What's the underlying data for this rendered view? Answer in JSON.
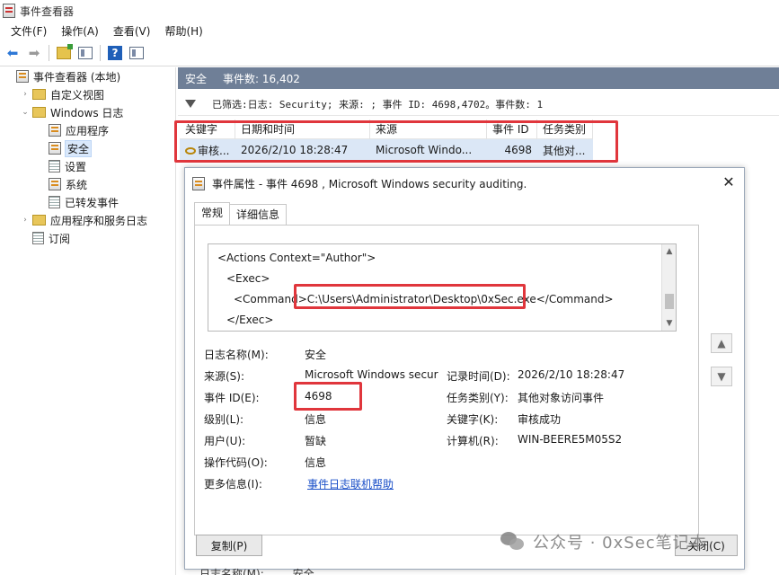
{
  "window": {
    "title": "事件查看器"
  },
  "menu": [
    "文件(F)",
    "操作(A)",
    "查看(V)",
    "帮助(H)"
  ],
  "toolbar": {
    "help_label": "?"
  },
  "tree": [
    {
      "label": "事件查看器 (本地)",
      "indent": 0,
      "caret": "",
      "icon": "node"
    },
    {
      "label": "自定义视图",
      "indent": 1,
      "caret": "›",
      "icon": "folder"
    },
    {
      "label": "Windows 日志",
      "indent": 1,
      "caret": "⌄",
      "icon": "folder"
    },
    {
      "label": "应用程序",
      "indent": 2,
      "caret": "",
      "icon": "node"
    },
    {
      "label": "安全",
      "indent": 2,
      "caret": "",
      "icon": "node",
      "selected": true
    },
    {
      "label": "设置",
      "indent": 2,
      "caret": "",
      "icon": "sub"
    },
    {
      "label": "系统",
      "indent": 2,
      "caret": "",
      "icon": "node"
    },
    {
      "label": "已转发事件",
      "indent": 2,
      "caret": "",
      "icon": "sub"
    },
    {
      "label": "应用程序和服务日志",
      "indent": 1,
      "caret": "›",
      "icon": "folder"
    },
    {
      "label": "订阅",
      "indent": 1,
      "caret": "",
      "icon": "sub"
    }
  ],
  "main": {
    "title": "安全",
    "event_count": "事件数: 16,402",
    "filter_text": "已筛选:日志: Security; 来源: ; 事件 ID: 4698,4702。事件数: 1",
    "columns": [
      "关键字",
      "日期和时间",
      "来源",
      "事件 ID",
      "任务类别"
    ],
    "row": {
      "keyword": "审核...",
      "datetime": "2026/2/10 18:28:47",
      "source": "Microsoft Windo...",
      "event_id": "4698",
      "category": "其他对..."
    }
  },
  "dialog": {
    "title": "事件属性 - 事件 4698 , Microsoft Windows security auditing.",
    "close": "✕",
    "tabs": [
      "常规",
      "详细信息"
    ],
    "xml": {
      "line1": "<Actions Context=\"Author\">",
      "line2": "<Exec>",
      "line3_open": "<Command>",
      "line3_value": "C:\\Users\\Administrator\\Desktop\\0xSec.exe",
      "line3_close": "</Command>",
      "line4": "</Exec>"
    },
    "props": {
      "log_name_label": "日志名称(M):",
      "log_name": "安全",
      "source_label": "来源(S):",
      "source": "Microsoft Windows secur",
      "logged_label": "记录时间(D):",
      "logged": "2026/2/10 18:28:47",
      "event_id_label": "事件 ID(E):",
      "event_id": "4698",
      "task_label": "任务类别(Y):",
      "task": "其他对象访问事件",
      "level_label": "级别(L):",
      "level": "信息",
      "keywords_label": "关键字(K):",
      "keywords": "审核成功",
      "user_label": "用户(U):",
      "user": "暂缺",
      "computer_label": "计算机(R):",
      "computer": "WIN-BEERE5M05S2",
      "opcode_label": "操作代码(O):",
      "opcode": "信息",
      "more_info_label": "更多信息(I):",
      "more_info_link": "事件日志联机帮助"
    },
    "side_buttons": {
      "up": "▲",
      "down": "▼"
    },
    "copy_button": "复制(P)",
    "close_button": "关闭(C)"
  },
  "bottom_strip": {
    "label": "日志名称(M):",
    "value": "安全"
  },
  "watermark": "公众号 · 0xSec笔记本"
}
